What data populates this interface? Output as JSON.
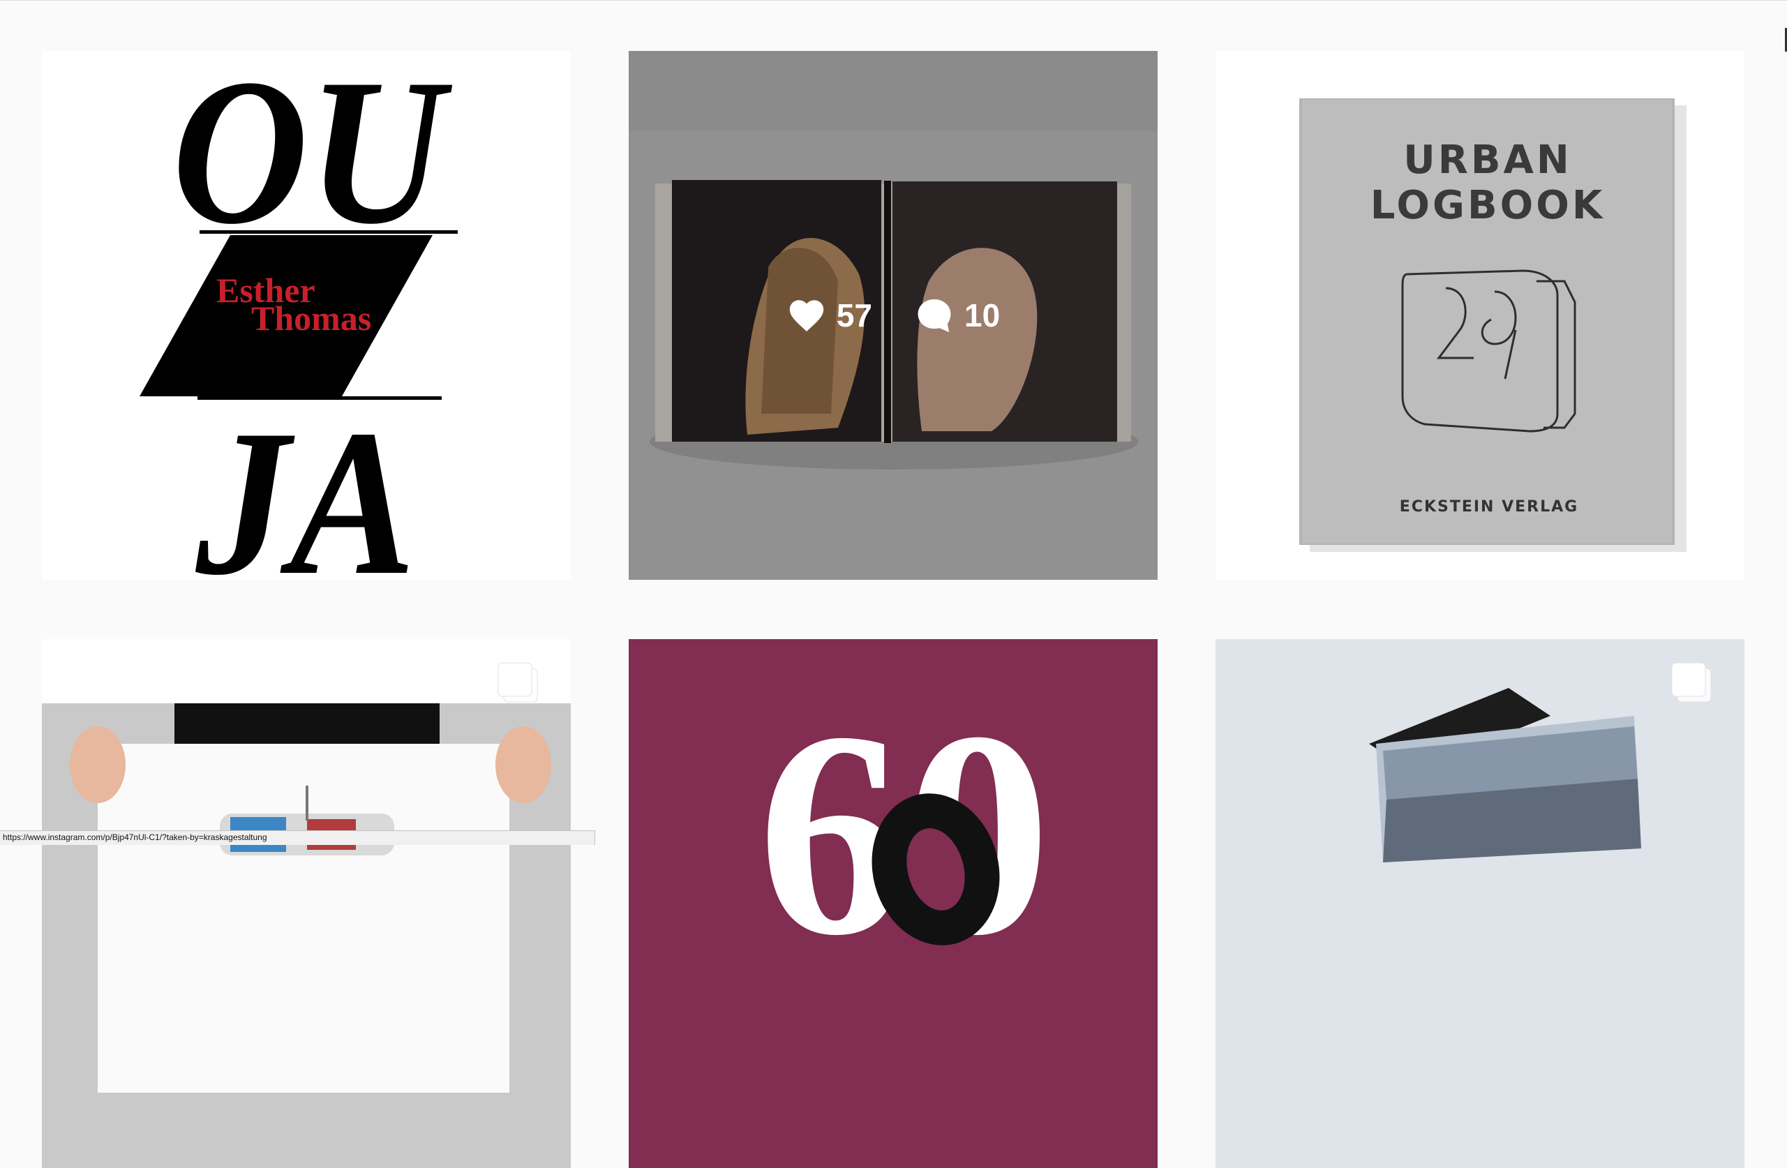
{
  "posts": [
    {
      "id": "post-ou-ja",
      "poster_lines": [
        "OU",
        "JA"
      ],
      "poster_name": [
        "Esther",
        "Thomas"
      ]
    },
    {
      "id": "post-open-book",
      "hover": {
        "likes": "57",
        "comments": "10"
      }
    },
    {
      "id": "post-urban-logbook",
      "cover_title": [
        "URBAN",
        "LOGBOOK"
      ],
      "cover_number": "29",
      "publisher": "ECKSTEIN VERLAG"
    },
    {
      "id": "post-poster-person",
      "multi": true
    },
    {
      "id": "post-sixty",
      "number": "60"
    },
    {
      "id": "post-magazine",
      "multi": true
    }
  ],
  "icons": {
    "like": "heart-icon",
    "comment": "speech-bubble-icon",
    "carousel": "carousel-icon"
  },
  "colors": {
    "page_bg": "#fafafa",
    "red_accent": "#c8202a",
    "maroon": "#822d52"
  },
  "status_bar": {
    "url": "https://www.instagram.com/p/Bjp47nUl-C1/?taken-by=kraskagestaltung"
  }
}
